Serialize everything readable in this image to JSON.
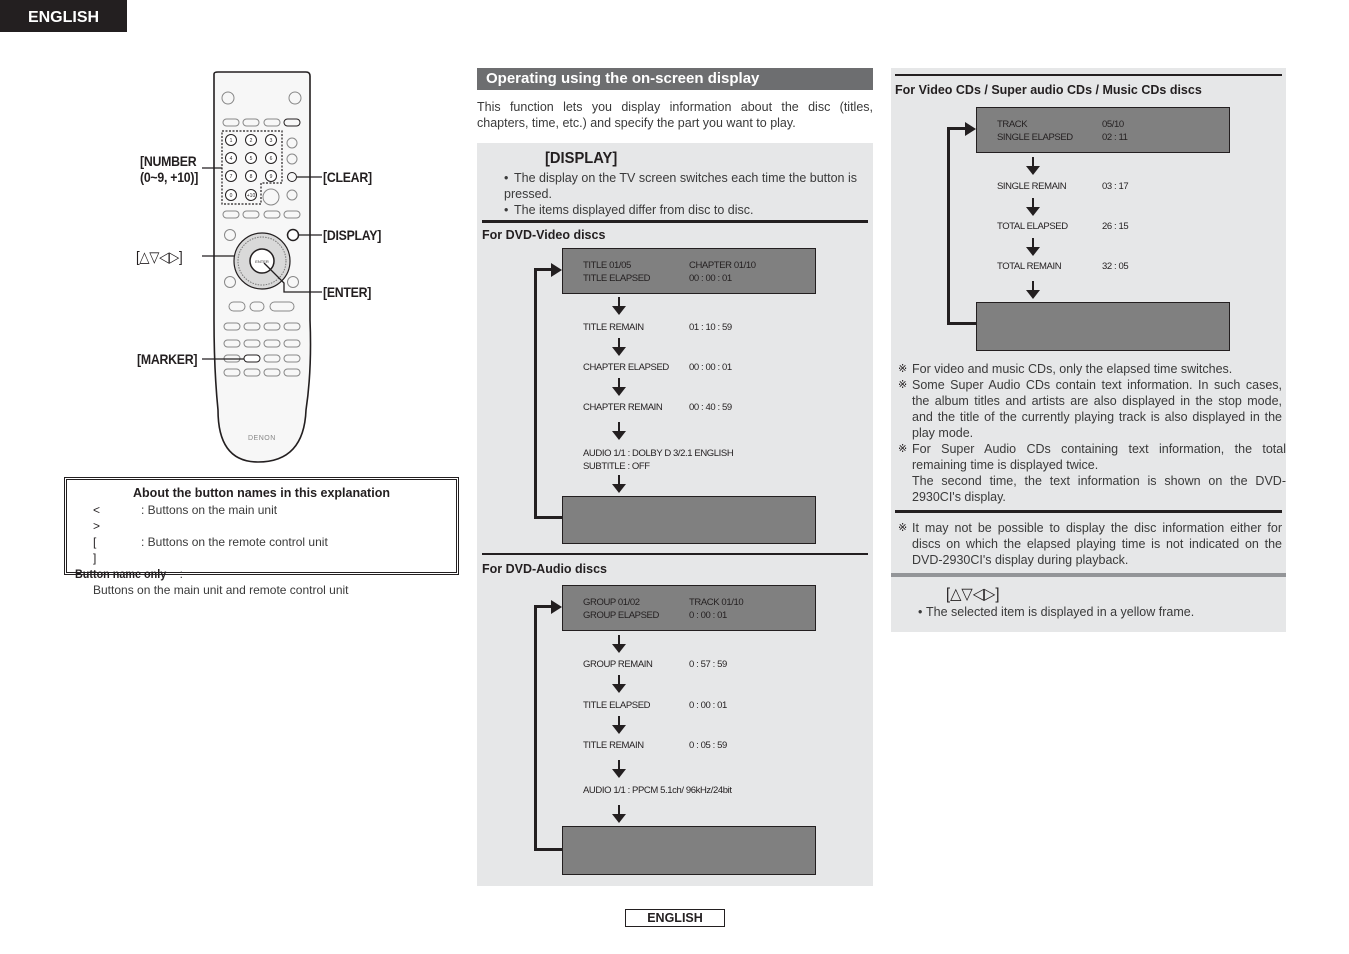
{
  "header": {
    "language_tab": "ENGLISH"
  },
  "remote": {
    "brand": "DENON",
    "callouts": {
      "number": "[NUMBER",
      "number_range": "(0~9, +10)]",
      "clear": "[CLEAR]",
      "display": "[DISPLAY]",
      "cursor": "[△▽◁▷]",
      "enter": "[ENTER]",
      "marker": "[MARKER]"
    },
    "number_keys": [
      "1",
      "2",
      "3",
      "4",
      "5",
      "6",
      "7",
      "8",
      "9",
      "0",
      "+10"
    ]
  },
  "about_box": {
    "title": "About the button names in this explanation",
    "rows": [
      {
        "symbol": "< >",
        "text": ": Buttons on the main unit"
      },
      {
        "symbol": "[ ]",
        "text": ": Buttons on the remote control unit"
      }
    ],
    "button_name_only_label": "Button name only",
    "button_name_only_colon": " :",
    "button_name_only_text": "Buttons on the main unit and remote control unit"
  },
  "section": {
    "title": "Operating using the on-screen display",
    "intro": "This function lets you display information about the disc (titles, chapters, time, etc.) and specify the part you want to play."
  },
  "display_step": {
    "button": "[DISPLAY]",
    "bullets": [
      "The display on the TV screen switches each time the button is pressed.",
      "The items displayed differ from disc to disc."
    ]
  },
  "dvd_video": {
    "heading": "For DVD-Video discs",
    "first_screen": {
      "line1_label": "TITLE 01/05",
      "line1_value": "CHAPTER 01/10",
      "line2_label": "TITLE ELAPSED",
      "line2_value": "00 : 00 : 01"
    },
    "steps": [
      {
        "label": "TITLE REMAIN",
        "value": "01 : 10 : 59"
      },
      {
        "label": "CHAPTER ELAPSED",
        "value": "00 : 00 : 01"
      },
      {
        "label": "CHAPTER REMAIN",
        "value": "00 : 40 : 59"
      }
    ],
    "audio_line": "AUDIO 1/1 : DOLBY D 3/2.1 ENGLISH",
    "subtitle_line": "SUBTITLE : OFF"
  },
  "dvd_audio": {
    "heading": "For DVD-Audio discs",
    "first_screen": {
      "line1_label": "GROUP 01/02",
      "line1_value": "TRACK 01/10",
      "line2_label": "GROUP ELAPSED",
      "line2_value": "0 : 00 : 01"
    },
    "steps": [
      {
        "label": "GROUP REMAIN",
        "value": "0 : 57 : 59"
      },
      {
        "label": "TITLE ELAPSED",
        "value": "0 : 00 : 01"
      },
      {
        "label": "TITLE REMAIN",
        "value": "0 : 05 : 59"
      }
    ],
    "audio_line": "AUDIO 1/1 : PPCM 5.1ch/  96kHz/24bit"
  },
  "cd": {
    "heading": "For Video CDs / Super audio CDs / Music CDs discs",
    "first_screen": {
      "line1_label": "TRACK",
      "line1_value": "05/10",
      "line2_label": "SINGLE ELAPSED",
      "line2_value": "02 : 11"
    },
    "steps": [
      {
        "label": "SINGLE REMAIN",
        "value": "03 : 17"
      },
      {
        "label": "TOTAL ELAPSED",
        "value": "26 : 15"
      },
      {
        "label": "TOTAL REMAIN",
        "value": "32 : 05"
      }
    ],
    "note_mark": "※",
    "notes": [
      "For video and music CDs, only the elapsed time switches.",
      "Some Super Audio CDs contain text information. In such cases, the album titles and artists are also displayed in the stop mode, and the title of the currently playing track is also displayed in the play mode.",
      "For Super Audio CDs containing text information, the total remaining time is displayed twice.",
      "The second time, the text information is shown on the DVD-2930CI's display."
    ],
    "caution": "It may not be possible to display the disc information either for discs on which the elapsed playing time is not indicated on the DVD-2930CI's display during playback."
  },
  "cursor_step": {
    "button": "[△▽◁▷]",
    "bullet": "The selected item is displayed in a yellow frame."
  },
  "footer": {
    "language": "ENGLISH"
  },
  "colors": {
    "ink": "#231f20",
    "panel": "#e6e7e8",
    "header_bar": "#6d6e70",
    "osd_screen": "#808080"
  }
}
